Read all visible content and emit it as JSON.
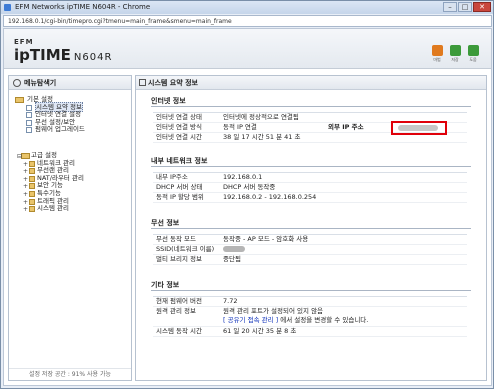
{
  "window": {
    "title": "EFM Networks  ipTIME N604R - Chrome",
    "url": "192.168.0.1/cgi-bin/timepro.cgi?tmenu=main_frame&smenu=main_frame"
  },
  "header": {
    "brand_small": "EFM",
    "logo_text": "ipTIME",
    "model": "N604R",
    "icons": [
      {
        "name": "wizard-icon",
        "label": "마법",
        "color": "#e07a1e"
      },
      {
        "name": "save-icon",
        "label": "저장",
        "color": "#3c9a3a"
      },
      {
        "name": "help-icon",
        "label": "도움",
        "color": "#3c9a3a"
      }
    ]
  },
  "left_panel": {
    "title": "메뉴탐색기",
    "groups": [
      {
        "label": "기본 설정",
        "items": [
          "시스템 요약 정보",
          "인터넷 연결 설정",
          "무선 설정/보안",
          "펌웨어 업그레이드"
        ],
        "selected_index": 0
      },
      {
        "label": "고급 설정",
        "items": [
          "네트워크 관리",
          "무선랜 관리",
          "NAT/라우터 관리",
          "보안 기능",
          "특수기능",
          "트래픽 관리",
          "시스템 관리"
        ]
      }
    ],
    "footer": "설정 저장 공간 : 91% 사용 가능"
  },
  "right_panel": {
    "title": "시스템 요약 정보",
    "sections": [
      {
        "title": "인터넷 정보",
        "rows": [
          {
            "key": "인터넷 연결 상태",
            "value": "인터넷에 정상적으로 연결됨"
          },
          {
            "key": "인터넷 연결 방식",
            "value": "동적 IP 연결",
            "extra_key": "외부 IP 주소"
          },
          {
            "key": "인터넷 연결 시간",
            "value": "38 일 17 시간 51 분 41 초"
          }
        ]
      },
      {
        "title": "내부 네트워크 정보",
        "rows": [
          {
            "key": "내부 IP주소",
            "value": "192.168.0.1"
          },
          {
            "key": "DHCP 서버 상태",
            "value": "DHCP 서버 동작중"
          },
          {
            "key": "동적 IP 할당 범위",
            "value": "192.168.0.2 - 192.168.0.254"
          }
        ]
      },
      {
        "title": "무선 정보",
        "rows": [
          {
            "key": "무선 동작 모드",
            "value": "동작중 - AP 모드 - 암호화 사용"
          },
          {
            "key": "SSID(네트워크 이름)",
            "value": ""
          },
          {
            "key": "멀티 브리지 정보",
            "value": "중단됨"
          }
        ]
      },
      {
        "title": "기타 정보",
        "rows": [
          {
            "key": "현재 펌웨어 버전",
            "value": "7.72"
          },
          {
            "key": "원격 관리 정보",
            "value": "원격 관리 포트가 설정되어 있지 않음",
            "link": "[ 공유기 접속 관리 ]",
            "link_suffix": " 에서 설정을 변경할 수 있습니다."
          },
          {
            "key": "시스템 동작 시간",
            "value": "61 일 20 시간 35 분 8 초"
          }
        ]
      }
    ]
  }
}
